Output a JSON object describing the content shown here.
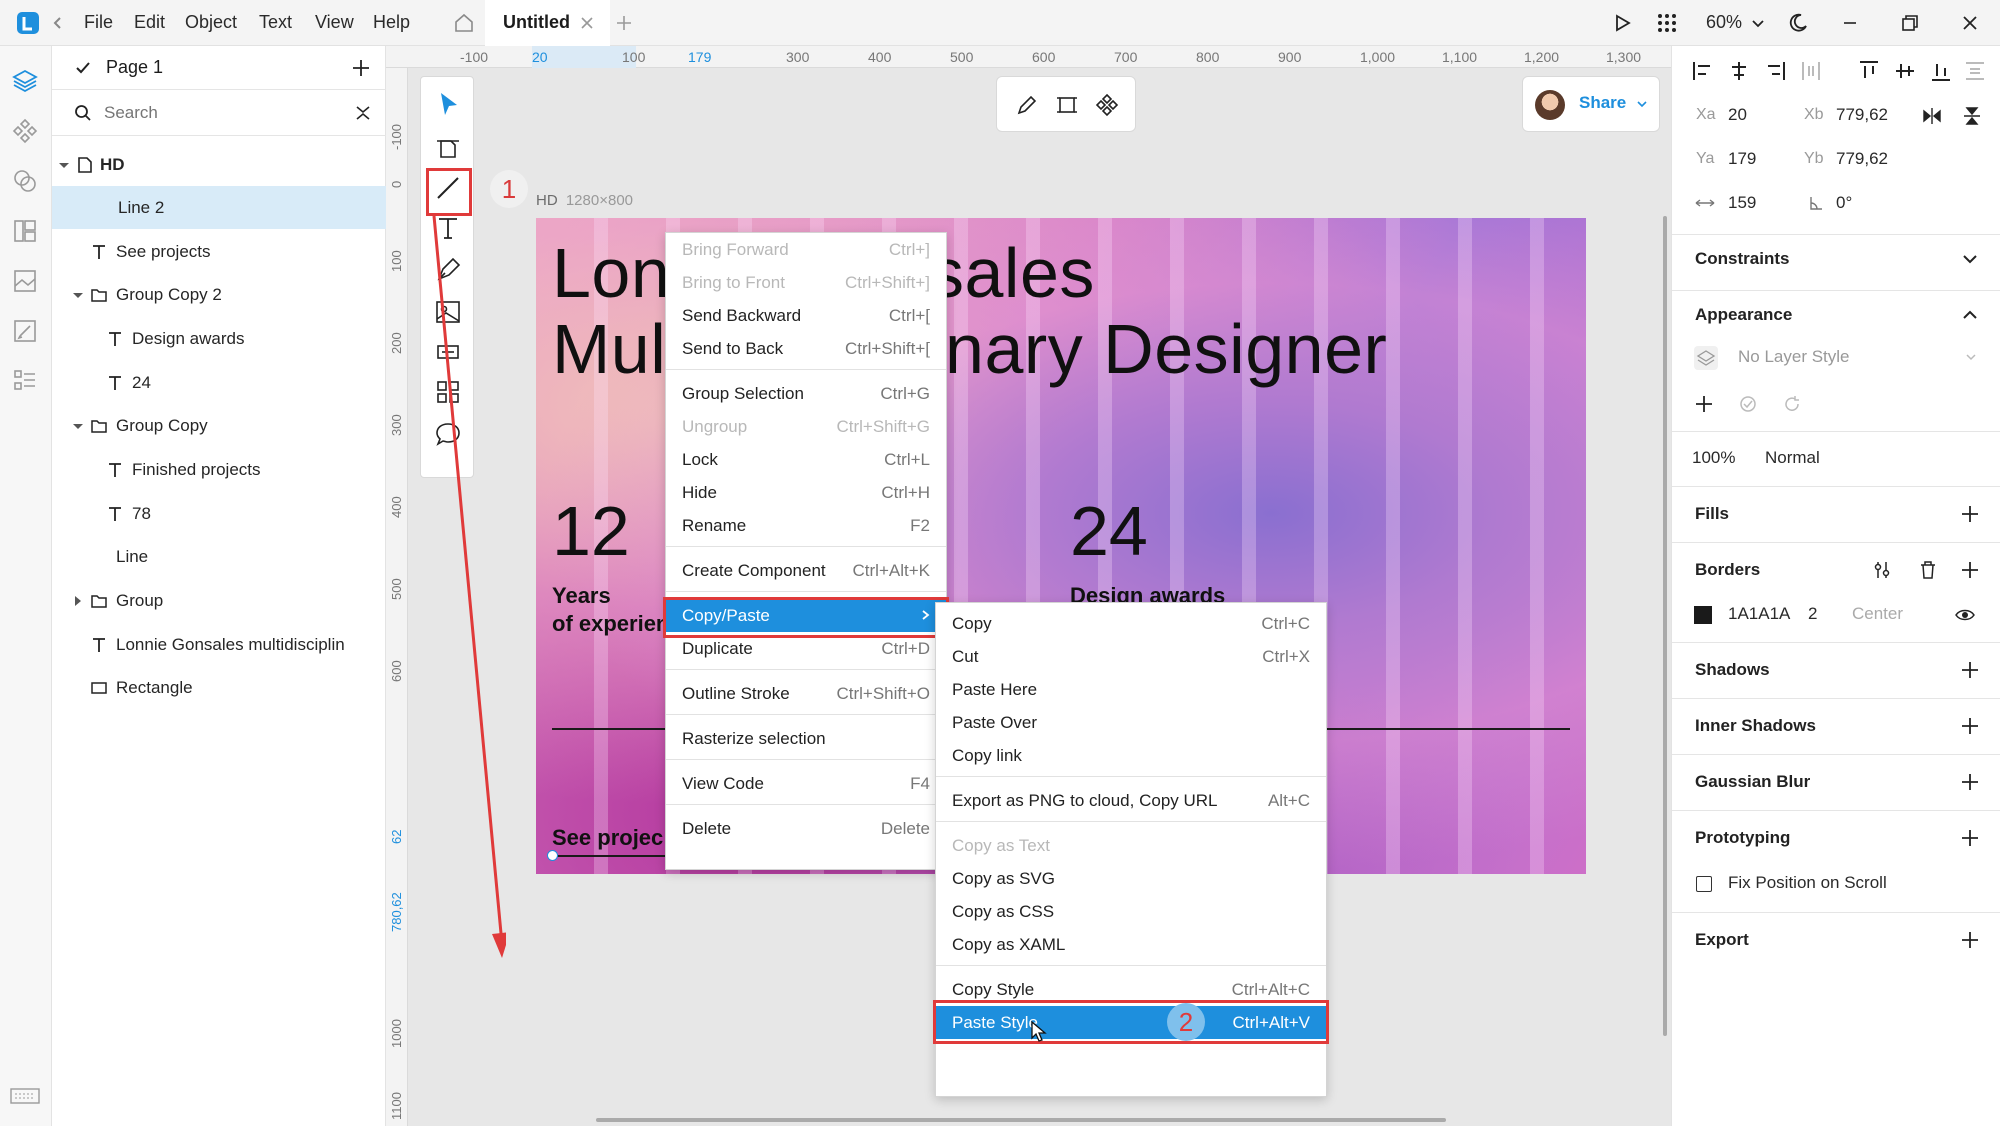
{
  "titlebar": {
    "menus": [
      "File",
      "Edit",
      "Object",
      "Text",
      "View",
      "Help"
    ],
    "tab_title": "Untitled",
    "zoom": "60%",
    "icons": [
      "app-logo-icon",
      "back-chevron-icon",
      "home-icon",
      "close-tab-icon",
      "new-tab-icon",
      "play-icon",
      "apps-grid-icon",
      "moon-icon",
      "minimize-icon",
      "restore-icon",
      "close-icon"
    ]
  },
  "layers": {
    "page_name": "Page 1",
    "search_placeholder": "Search",
    "items": [
      {
        "label": "HD"
      },
      {
        "label": "Line 2"
      },
      {
        "label": "See projects"
      },
      {
        "label": "Group Copy 2"
      },
      {
        "label": "Design awards"
      },
      {
        "label": "24"
      },
      {
        "label": "Group Copy"
      },
      {
        "label": "Finished projects"
      },
      {
        "label": "78"
      },
      {
        "label": "Line"
      },
      {
        "label": "Group"
      },
      {
        "label": "Lonnie Gonsales multidisciplin"
      },
      {
        "label": "Rectangle"
      }
    ]
  },
  "ruler": {
    "top": [
      "-100",
      "20",
      "100",
      "179",
      "300",
      "400",
      "500",
      "600",
      "700",
      "800",
      "900",
      "1,000",
      "1,100",
      "1,200",
      "1,300"
    ],
    "left": [
      "-100",
      "0",
      "100",
      "200",
      "300",
      "400",
      "500",
      "600",
      "62",
      "780,62",
      "1000",
      "1100"
    ]
  },
  "canvas": {
    "artboard_name": "HD",
    "artboard_size": "1280×800",
    "share_label": "Share",
    "hero_line1_left": "Lon",
    "hero_line1_right": "sales",
    "hero_line2_left": "Mul",
    "hero_line2_right": "inary Designer",
    "stat1_value": "12",
    "stat1_label_line1": "Years",
    "stat1_label_line2": "of experien",
    "stat2_value": "24",
    "stat2_label": "Design awards",
    "cta": "See projec"
  },
  "context_menu": {
    "items": [
      {
        "label": "Bring Forward",
        "shortcut": "Ctrl+]",
        "disabled": true
      },
      {
        "label": "Bring to Front",
        "shortcut": "Ctrl+Shift+]",
        "disabled": true
      },
      {
        "label": "Send Backward",
        "shortcut": "Ctrl+["
      },
      {
        "label": "Send to Back",
        "shortcut": "Ctrl+Shift+["
      },
      {
        "label": "Group Selection",
        "shortcut": "Ctrl+G"
      },
      {
        "label": "Ungroup",
        "shortcut": "Ctrl+Shift+G",
        "disabled": true
      },
      {
        "label": "Lock",
        "shortcut": "Ctrl+L"
      },
      {
        "label": "Hide",
        "shortcut": "Ctrl+H"
      },
      {
        "label": "Rename",
        "shortcut": "F2"
      },
      {
        "label": "Create Component",
        "shortcut": "Ctrl+Alt+K"
      },
      {
        "label": "Copy/Paste",
        "shortcut": ""
      },
      {
        "label": "Duplicate",
        "shortcut": "Ctrl+D"
      },
      {
        "label": "Outline Stroke",
        "shortcut": "Ctrl+Shift+O"
      },
      {
        "label": "Rasterize selection",
        "shortcut": ""
      },
      {
        "label": "View Code",
        "shortcut": "F4"
      },
      {
        "label": "Delete",
        "shortcut": "Delete"
      }
    ]
  },
  "submenu": {
    "items": [
      {
        "label": "Copy",
        "shortcut": "Ctrl+C"
      },
      {
        "label": "Cut",
        "shortcut": "Ctrl+X"
      },
      {
        "label": "Paste Here",
        "shortcut": ""
      },
      {
        "label": "Paste Over",
        "shortcut": ""
      },
      {
        "label": "Copy link",
        "shortcut": ""
      },
      {
        "label": "Export as PNG to cloud, Copy URL",
        "shortcut": "Alt+C"
      },
      {
        "label": "Copy as Text",
        "shortcut": "",
        "disabled": true
      },
      {
        "label": "Copy as SVG",
        "shortcut": ""
      },
      {
        "label": "Copy as CSS",
        "shortcut": ""
      },
      {
        "label": "Copy as XAML",
        "shortcut": ""
      },
      {
        "label": "Copy Style",
        "shortcut": "Ctrl+Alt+C"
      },
      {
        "label": "Paste Style",
        "shortcut": "Ctrl+Alt+V"
      }
    ]
  },
  "annotations": {
    "step1": "1",
    "step2": "2"
  },
  "inspector": {
    "xa_label": "Xa",
    "xa": "20",
    "xb_label": "Xb",
    "xb": "779,62",
    "ya_label": "Ya",
    "ya": "179",
    "yb_label": "Yb",
    "yb": "779,62",
    "length": "159",
    "angle": "0°",
    "constraints": "Constraints",
    "appearance": "Appearance",
    "layer_style": "No Layer Style",
    "opacity": "100%",
    "blend": "Normal",
    "fills": "Fills",
    "borders": "Borders",
    "border_color": "1A1A1A",
    "border_color_hex": "#1a1a1a",
    "border_width": "2",
    "border_position": "Center",
    "shadows": "Shadows",
    "inner_shadows": "Inner Shadows",
    "gaussian_blur": "Gaussian Blur",
    "prototyping": "Prototyping",
    "fix_position": "Fix Position on Scroll",
    "export": "Export"
  },
  "colors": {
    "accent": "#1e8fdd",
    "annotation": "#e03a3a",
    "selection": "#d8ebf8"
  }
}
